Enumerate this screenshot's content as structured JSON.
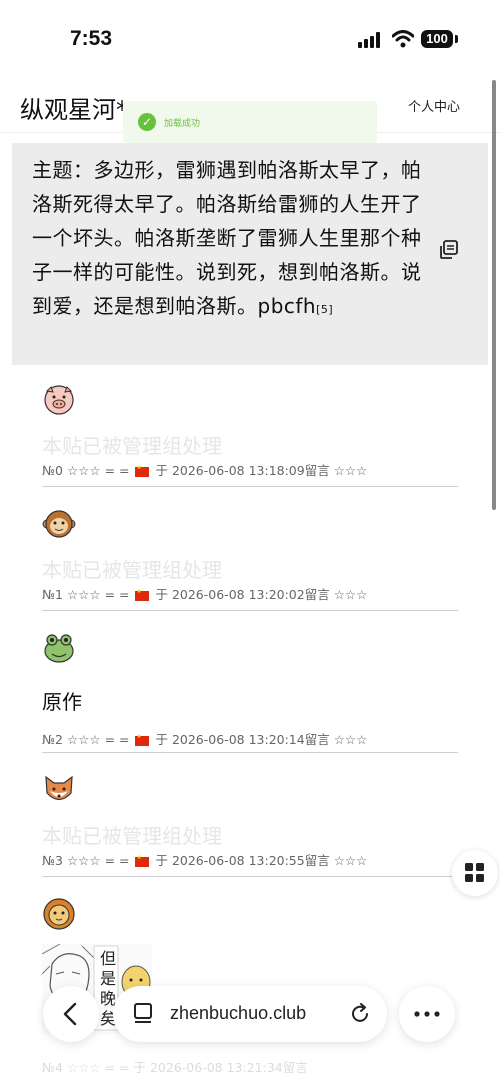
{
  "status": {
    "time": "7:53",
    "battery": "100"
  },
  "header": {
    "site_title": "纵观星河*",
    "nav_faint_1": "~~~~",
    "nav_faint_2": "~~~~~",
    "nav_faint_3": "~~~",
    "user_center": "个人中心"
  },
  "toast": {
    "text": "加载成功"
  },
  "topic": {
    "text": "主题：多边形，雷狮遇到帕洛斯太早了，帕洛斯死得太早了。帕洛斯给雷狮的人生开了一个坏头。帕洛斯垄断了雷狮人生里那个种子一样的可能性。说到死，想到帕洛斯。说到爱，还是想到帕洛斯。pbcfh",
    "ref": "[5]"
  },
  "posts": [
    {
      "avatar": "pig-avatar",
      "body": "本贴已被管理组处理",
      "deleted": true,
      "no": "№0",
      "rating_left": "☆☆☆",
      "sep": "= =",
      "yu": "于",
      "datetime": "2026-06-08 13:18:09留言",
      "rating_right": "☆☆☆"
    },
    {
      "avatar": "monkey-avatar",
      "body": "本贴已被管理组处理",
      "deleted": true,
      "no": "№1",
      "rating_left": "☆☆☆",
      "sep": "= =",
      "yu": "于",
      "datetime": "2026-06-08 13:20:02留言",
      "rating_right": "☆☆☆"
    },
    {
      "avatar": "frog-avatar",
      "body": "原作",
      "deleted": false,
      "no": "№2",
      "rating_left": "☆☆☆",
      "sep": "= =",
      "yu": "于",
      "datetime": "2026-06-08 13:20:14留言",
      "rating_right": "☆☆☆"
    },
    {
      "avatar": "fox-avatar",
      "body": "本贴已被管理组处理",
      "deleted": true,
      "no": "№3",
      "rating_left": "☆☆☆",
      "sep": "= =",
      "yu": "于",
      "datetime": "2026-06-08 13:20:55留言",
      "rating_right": "☆☆☆"
    },
    {
      "avatar": "lion-avatar",
      "body": "",
      "deleted": false,
      "no": "№4",
      "rating_left": "☆☆☆",
      "sep": "= =",
      "yu": "于",
      "datetime": "2026-06-08 13:21:34留言",
      "rating_right": "☆☆☆"
    }
  ],
  "comic": {
    "caption": "但是晚矣"
  },
  "browser": {
    "url": "zhenbuchuo.club"
  },
  "colors": {
    "toast_green": "#67c23a",
    "topic_bg": "#ececec",
    "deleted_text": "#e6e6e6"
  }
}
